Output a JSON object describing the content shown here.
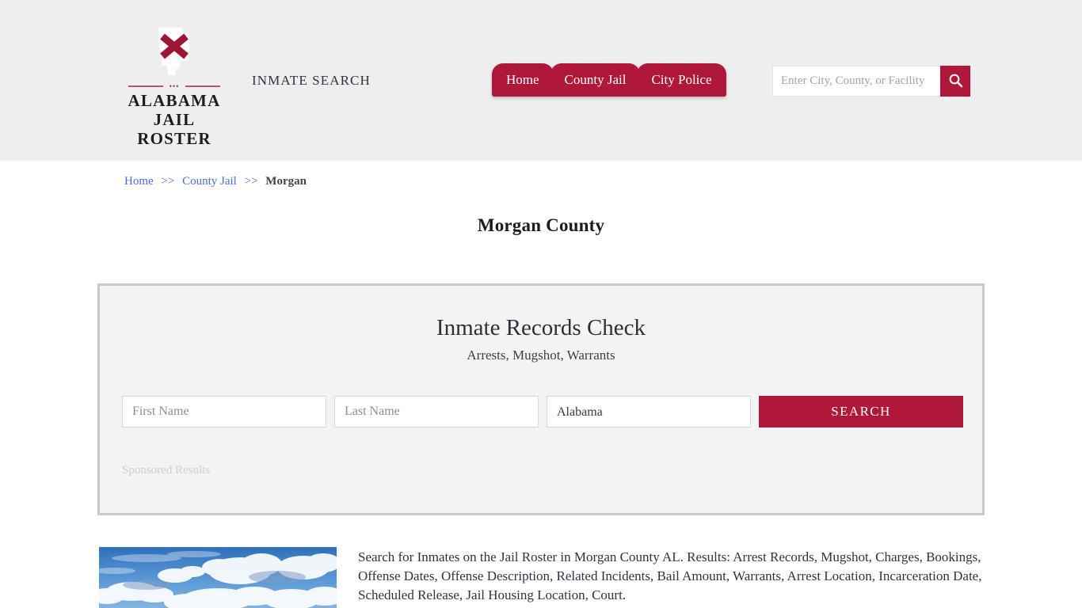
{
  "header": {
    "logo": {
      "icon": "alabama-state-cross-icon",
      "word1": "ALABAMA",
      "word2": "JAIL ROSTER",
      "divider_dots": "•••"
    },
    "tagline": "INMATE SEARCH",
    "nav": [
      {
        "label": "Home",
        "name": "nav-home"
      },
      {
        "label": "County Jail",
        "name": "nav-county-jail"
      },
      {
        "label": "City Police",
        "name": "nav-city-police"
      }
    ],
    "search": {
      "placeholder": "Enter City, County, or Facility",
      "value": "",
      "button_icon": "search-icon"
    },
    "colors": {
      "band": "#eeeeee",
      "accent": "#b01839"
    }
  },
  "breadcrumb": {
    "items": [
      {
        "label": "Home",
        "link": true
      },
      {
        "label": "County Jail",
        "link": true
      },
      {
        "label": "Morgan",
        "link": false
      }
    ],
    "separator": ">>"
  },
  "page": {
    "title": "Morgan County"
  },
  "records_panel": {
    "title": "Inmate Records Check",
    "subtitle": "Arrests, Mugshot, Warrants",
    "form": {
      "first_name_placeholder": "First Name",
      "first_name_value": "",
      "last_name_placeholder": "Last Name",
      "last_name_value": "",
      "state_selected": "Alabama",
      "state_options": [
        "Alabama"
      ],
      "search_button": "SEARCH"
    },
    "sponsored_label": "Sponsored Results"
  },
  "bottom": {
    "image_alt": "clouds-sky-photo",
    "description": "Search for Inmates on the Jail Roster in Morgan County AL. Results: Arrest Records, Mugshot, Charges, Bookings, Offense Dates, Offense Description, Related Incidents, Bail Amount, Warrants, Arrest Location, Incarceration Date, Scheduled Release, Jail Housing Location, Court."
  }
}
